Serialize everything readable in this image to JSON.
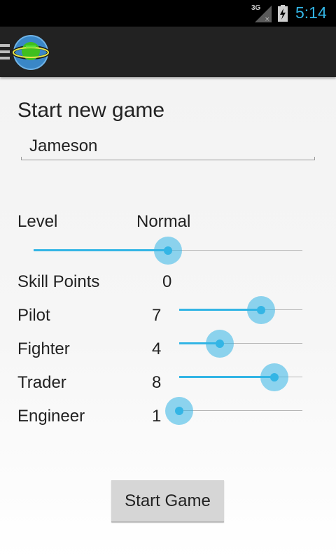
{
  "status_bar": {
    "network": "3G",
    "time": "5:14"
  },
  "action_bar": {
    "menu_icon": "hamburger-icon",
    "logo_icon": "planet-logo-icon"
  },
  "form": {
    "title": "Start new game",
    "name_value": "Jameson",
    "level": {
      "label": "Level",
      "value": "Normal",
      "slider_fraction": 0.5
    },
    "skill_points": {
      "label": "Skill Points",
      "value": "0"
    },
    "skills": [
      {
        "label": "Pilot",
        "value": "7"
      },
      {
        "label": "Fighter",
        "value": "4"
      },
      {
        "label": "Trader",
        "value": "8"
      },
      {
        "label": "Engineer",
        "value": "1"
      }
    ],
    "start_button": "Start Game"
  },
  "colors": {
    "accent": "#33b5e5",
    "action_bar": "#222222",
    "status_bar": "#000000"
  }
}
